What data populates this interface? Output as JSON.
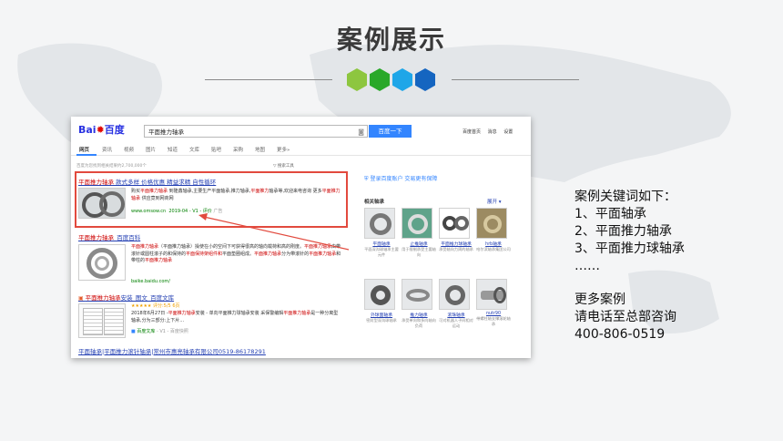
{
  "page": {
    "title": "案例展示",
    "hex_colors": [
      "#8dc63f",
      "#29a829",
      "#1fa6e8",
      "#1565c0"
    ]
  },
  "baidu": {
    "logo_left": "Bai",
    "logo_right": "百度",
    "search_value": "平面推力轴承",
    "camera_icon": "camera-icon",
    "search_button": "百度一下",
    "top_links": [
      "百度首页",
      "消息",
      "设置"
    ],
    "tabs": [
      "网页",
      "资讯",
      "视频",
      "图片",
      "知道",
      "文库",
      "贴吧",
      "采购",
      "地图",
      "更多»"
    ],
    "result_count": "百度为您找到相关结果约2,700,000个",
    "search_tools": "搜索工具",
    "accent": "#3385ff"
  },
  "results": {
    "ad": {
      "title_em": "平面推力轴承",
      "title_rest": " 款式多样 价格优惠 精益求精 自性循环",
      "text_a": "购买",
      "text_b": "平面推力轴承",
      "text_c": " 到隆鑫轴承,主要生产平面轴承,推力轴承,",
      "text_d": "平面推力",
      "text_e": "轴承",
      "text_f": "等,欢迎来电咨询 更多",
      "text_g": "平面推力轴承",
      "text_h": " 供应竟到网商网",
      "url": "www.omsow.cn",
      "date": "2019-04",
      "flags": "- V1 - 评价",
      "tag": "广告"
    },
    "baike": {
      "title_em": "平面推力轴承",
      "title_rest": "_百度百科",
      "t1": "平面推力轴承",
      "t2": "（平面推力轴承）操使在小的空间下可获得很高的轴向载荷和高的刚度。",
      "t3": "平面推力轴承",
      "t4": "由带滚针或圆柱滚子的和保持的",
      "t5": "平面保持架组件和",
      "t6": "平面垫圈组成。",
      "t7": "平面推力轴承",
      "t8": "分为带滚针的",
      "t9": "平面推力轴承",
      "t10": "和带柱的",
      "t11": "平面推力轴承",
      "url": "baike.baidu.com/"
    },
    "wenku": {
      "title_em": "平面推力轴承",
      "title_rest": "安装_图文_百度文库",
      "rating": "★★★★★ 评分:5/5 6页",
      "t1": "2018年6月27日 -",
      "t2": "平面推力轴承",
      "t3": "安装 - 单向平面推力球轴承安装 采保警编辑",
      "t4": "平面推力轴承",
      "t5": "是一种分离型轴承,分为三部分:上下片...",
      "source": "百度文库",
      "flags": "- V1 - 百度快照"
    },
    "bottom": {
      "title": "平面轴承|平面推力滚针轴承|常州市惠亮轴承有限公司0519-86178291"
    }
  },
  "right_panel": {
    "promo": "登录百度账户  交易更有保障",
    "heading": "相关轴承",
    "expand": "展开",
    "items": [
      {
        "name": "平面轴承",
        "desc": "平面深沟球轴承主要元件"
      },
      {
        "name": "止推轴承",
        "desc": "用于限制承受主要轴向"
      },
      {
        "name": "平面推力球轴承",
        "desc": "承受轴向力周的轴承"
      },
      {
        "name": "hrb轴承",
        "desc": "哈尔滨轴承集团公司"
      },
      {
        "name": "外球面轴承",
        "desc": "密封型深沟球轴承"
      },
      {
        "name": "推力轴承",
        "desc": "承受单向和多向轴向负荷"
      },
      {
        "name": "滚珠轴承",
        "desc": "可对机器人子间相对运动"
      },
      {
        "name": "nutr90",
        "desc": "带螺柱轴支撑滚轮轴承"
      }
    ]
  },
  "side": {
    "line1": "案例关键词如下：",
    "line2": "1、平面轴承",
    "line3": "2、平面推力轴承",
    "line4": "3、平面推力球轴承",
    "line5": "……",
    "line6": "更多案例",
    "line7": "请电话至总部咨询",
    "line8": "400-806-0519"
  }
}
